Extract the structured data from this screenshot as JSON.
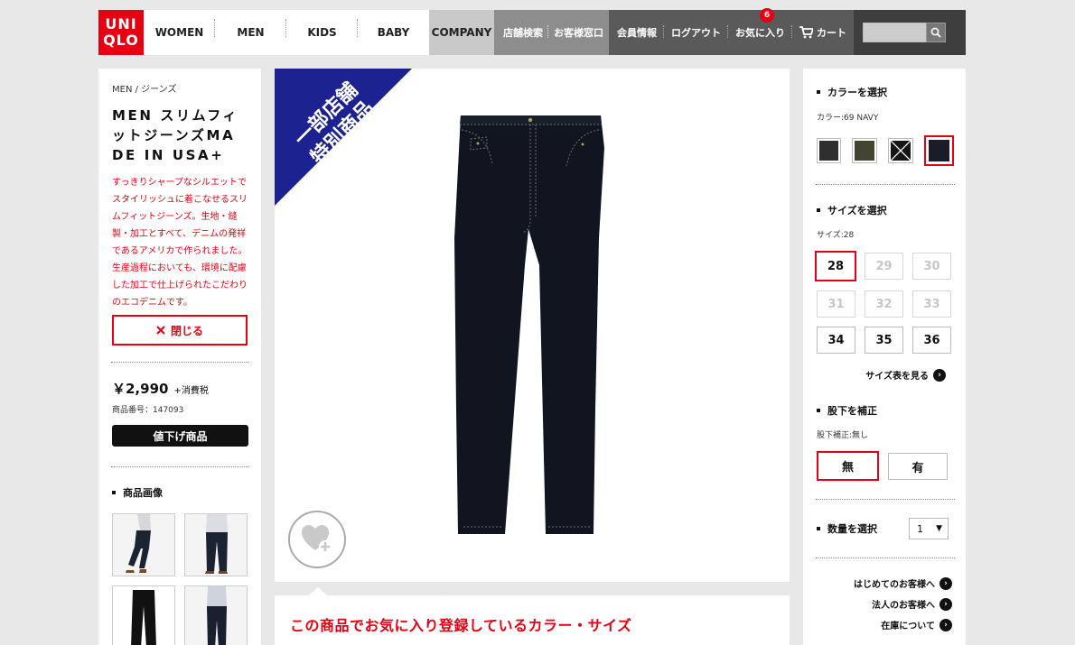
{
  "header": {
    "logo_top": "UNI",
    "logo_bottom": "QLO",
    "nav_primary": [
      "WOMEN",
      "MEN",
      "KIDS",
      "BABY"
    ],
    "company_label": "COMPANY",
    "nav_secondary": [
      "店舗検索",
      "お客様窓口"
    ],
    "account": {
      "member": "会員情報",
      "logout": "ログアウト",
      "favorites": "お気に入り",
      "favorites_count": "6",
      "cart": "カート"
    },
    "search_placeholder": ""
  },
  "product": {
    "breadcrumb": "MEN / ジーンズ",
    "title": "MEN スリムフィットジーンズMADE IN USA+",
    "description": "すっきりシャープなシルエットでスタイリッシュに着こなせるスリムフィットジーンズ。生地・縫製・加工とすべて、デニムの発祥であるアメリカで作られました。生産過程においても、環境に配慮した加工で仕上げられたこだわりのエコデニムです。",
    "close_label": "閉じる",
    "price": "￥2,990",
    "tax_label": "+消費税",
    "code_label": "商品番号：147093",
    "sale_label": "値下げ商品",
    "images_heading": "商品画像",
    "banner_line1": "一部店舗",
    "banner_line2": "特別商品",
    "favorite_panel_title": "この商品でお気に入り登録しているカラー・サイズ"
  },
  "options": {
    "color_heading": "カラーを選択",
    "color_selected": "カラー:69 NAVY",
    "colors": [
      {
        "name": "dark-gray",
        "hex": "#2f2f2f"
      },
      {
        "name": "olive",
        "hex": "#434432"
      },
      {
        "name": "black",
        "hex": "#161616"
      },
      {
        "name": "navy",
        "hex": "#1a1d27"
      }
    ],
    "size_heading": "サイズを選択",
    "size_selected": "サイズ:28",
    "sizes": [
      "28",
      "29",
      "30",
      "31",
      "32",
      "33",
      "34",
      "35",
      "36"
    ],
    "size_chart_label": "サイズ表を見る",
    "hem_heading": "股下を補正",
    "hem_selected": "股下補正:無し",
    "hem_none": "無",
    "hem_yes": "有",
    "qty_heading": "数量を選択",
    "qty_value": "1",
    "links": [
      "はじめてのお客様へ",
      "法人のお客様へ",
      "在庫について"
    ]
  },
  "colors": {
    "brand_red": "#e60012",
    "banner_blue": "#1c2290",
    "denim": "#11151f"
  }
}
